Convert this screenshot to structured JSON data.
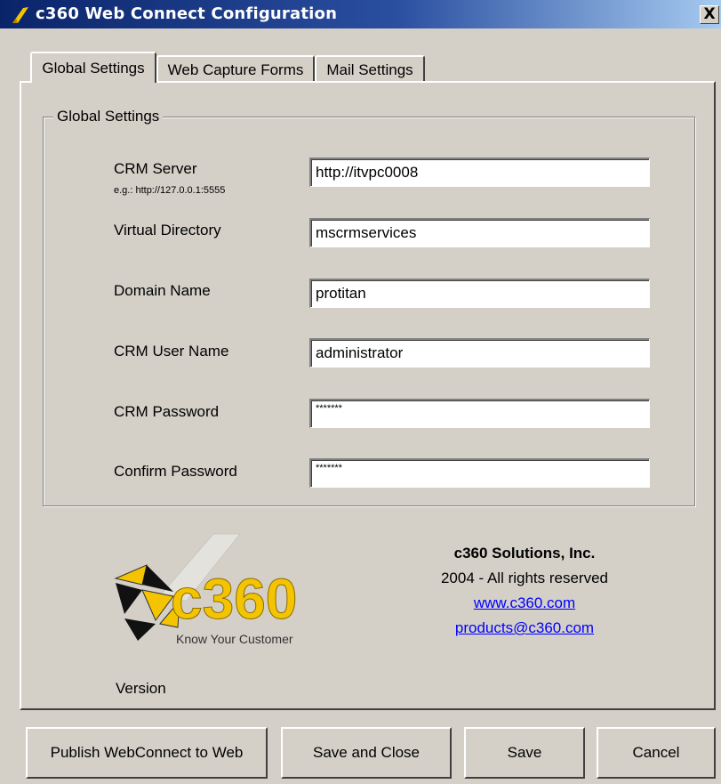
{
  "window": {
    "title": "c360 Web Connect Configuration",
    "close_label": "X"
  },
  "tabs": [
    {
      "label": "Global Settings",
      "active": true
    },
    {
      "label": "Web Capture Forms",
      "active": false
    },
    {
      "label": "Mail Settings",
      "active": false
    }
  ],
  "group": {
    "legend": "Global Settings",
    "fields": [
      {
        "label": "CRM Server",
        "hint": "e.g.: http://127.0.0.1:5555",
        "value": "http://itvpc0008"
      },
      {
        "label": "Virtual Directory",
        "value": "mscrmservices"
      },
      {
        "label": "Domain Name",
        "value": "protitan"
      },
      {
        "label": "CRM User Name",
        "value": "administrator"
      },
      {
        "label": "CRM Password",
        "value": "*******"
      },
      {
        "label": "Confirm Password",
        "value": "*******"
      }
    ]
  },
  "about": {
    "company": "c360 Solutions, Inc.",
    "copyright": "2004 - All rights reserved",
    "website": "www.c360.com",
    "email": "products@c360.com",
    "logo_text": "c360",
    "logo_tagline": "Know Your Customer",
    "version_label": "Version"
  },
  "buttons": {
    "publish": "Publish WebConnect to Web",
    "save_close": "Save and Close",
    "save": "Save",
    "cancel": "Cancel"
  },
  "colors": {
    "titlebar_start": "#0a246a",
    "titlebar_end": "#a6caf0",
    "dialog_bg": "#d4d0c8",
    "link": "#0000ff",
    "logo_yellow": "#f5c400"
  }
}
